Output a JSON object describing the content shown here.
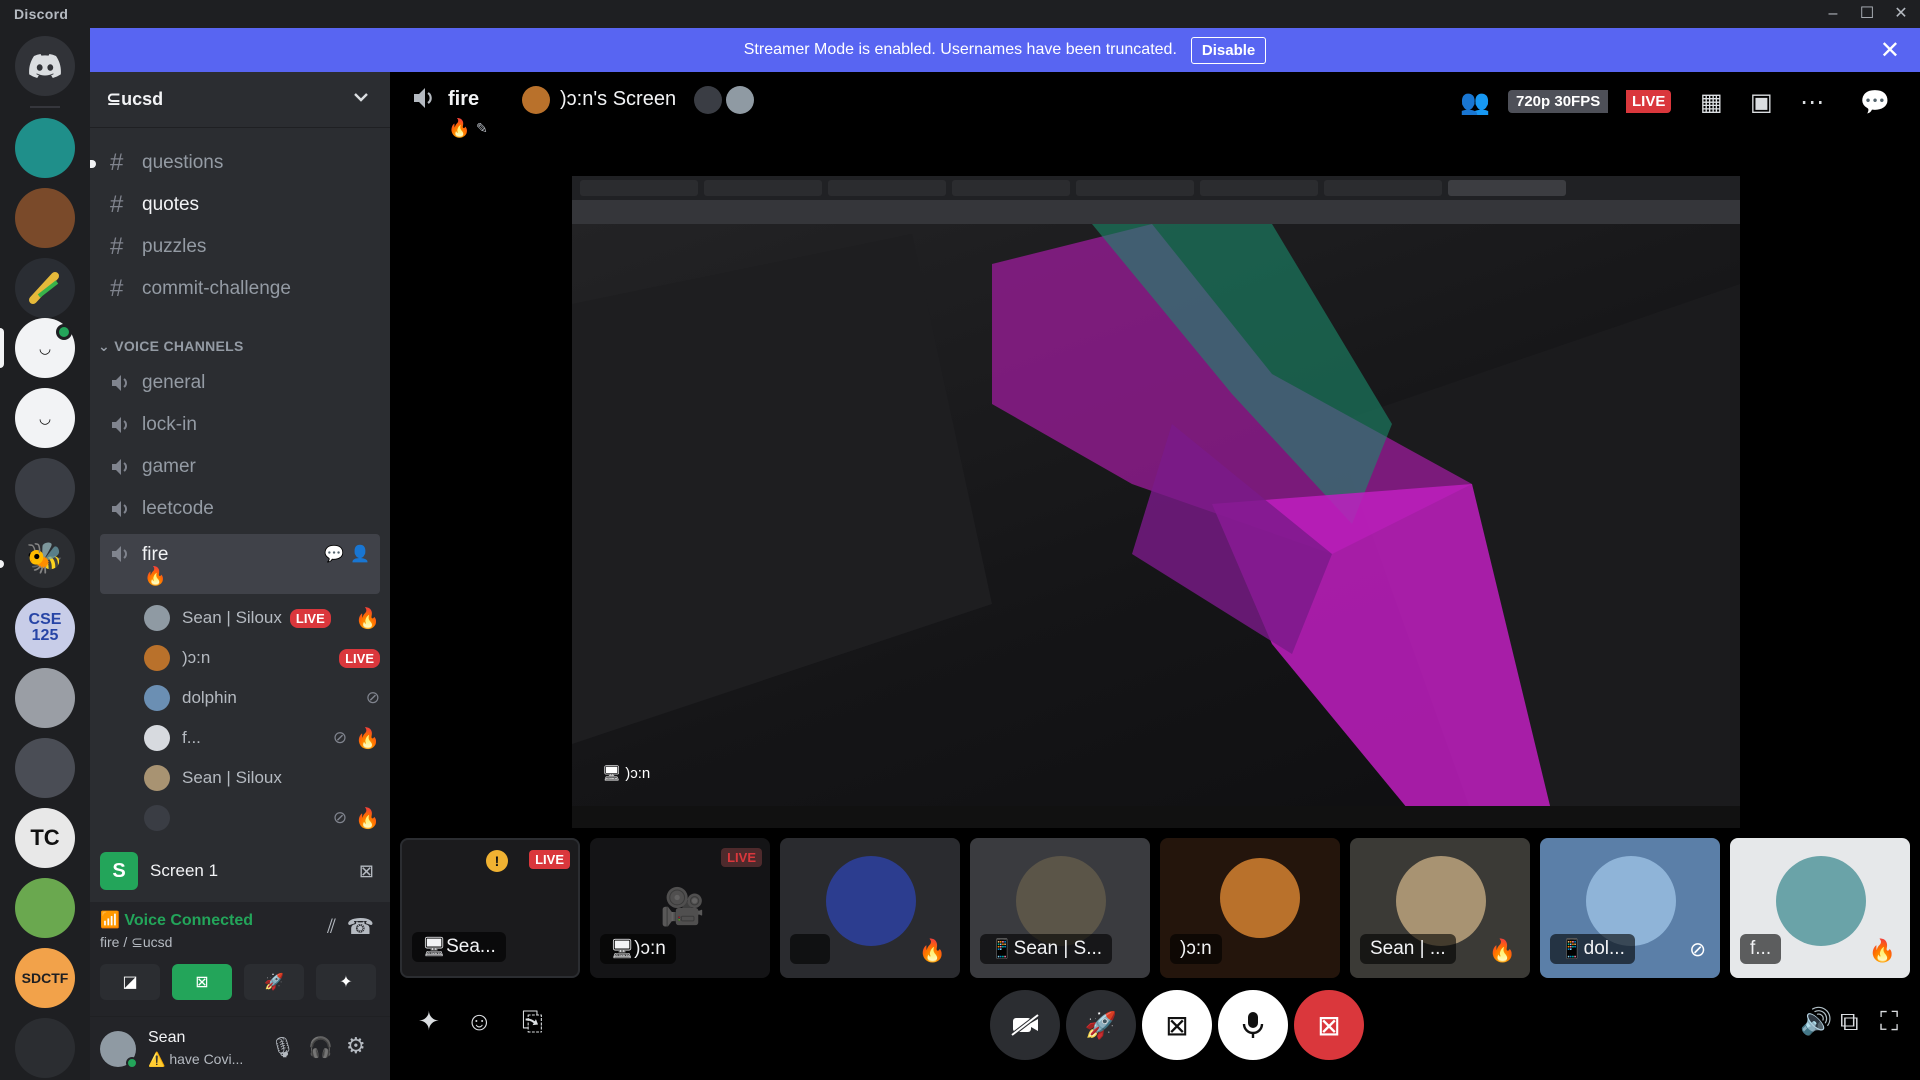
{
  "window": {
    "app_name": "Discord"
  },
  "banner": {
    "text": "Streamer Mode is enabled. Usernames have been truncated.",
    "button": "Disable"
  },
  "guild": {
    "name": "⊆ucsd"
  },
  "text_channels": [
    "questions",
    "quotes",
    "puzzles",
    "commit-challenge"
  ],
  "voice_category": "VOICE CHANNELS",
  "voice_channels": [
    "general",
    "lock-in",
    "gamer",
    "leetcode",
    "fire"
  ],
  "fire_emoji": "🔥",
  "fire_users": [
    {
      "name": "Sean | Siloux",
      "badge": "LIVE",
      "emoji": "🔥"
    },
    {
      "name": ")ɔ:n",
      "badge": "LIVE",
      "emoji": ""
    },
    {
      "name": "dolphin",
      "badge": "",
      "emoji": ""
    },
    {
      "name": "f...",
      "badge": "",
      "emoji": "🔥"
    },
    {
      "name": "Sean | Siloux",
      "badge": "",
      "emoji": ""
    },
    {
      "name": "",
      "badge": "",
      "emoji": "🔥"
    }
  ],
  "screen_row": {
    "avatar_letter": "S",
    "label": "Screen 1"
  },
  "voice_status": {
    "title": "Voice Connected",
    "subtitle": "fire / ⊆ucsd"
  },
  "user": {
    "name": "Sean",
    "status": "have Covi..."
  },
  "stage": {
    "channel": "fire",
    "channel_emoji": "🔥",
    "stream_title": ")ɔ:n's Screen",
    "quality": "720p 30FPS",
    "live": "LIVE",
    "overlay_name": ")ɔ:n"
  },
  "tiles": [
    {
      "label": "Sea...",
      "badge": "LIVE"
    },
    {
      "label": ")ɔ:n",
      "badge": "LIVE"
    },
    {
      "label": "",
      "badge": ""
    },
    {
      "label": "Sean | S...",
      "badge": ""
    },
    {
      "label": ")ɔ:n",
      "badge": ""
    },
    {
      "label": "Sean | ...",
      "badge": ""
    },
    {
      "label": "dol...",
      "badge": ""
    },
    {
      "label": "f...",
      "badge": ""
    }
  ],
  "colors": {
    "blurple": "#5865f2",
    "live_red": "#da373c",
    "green": "#23a55a"
  }
}
